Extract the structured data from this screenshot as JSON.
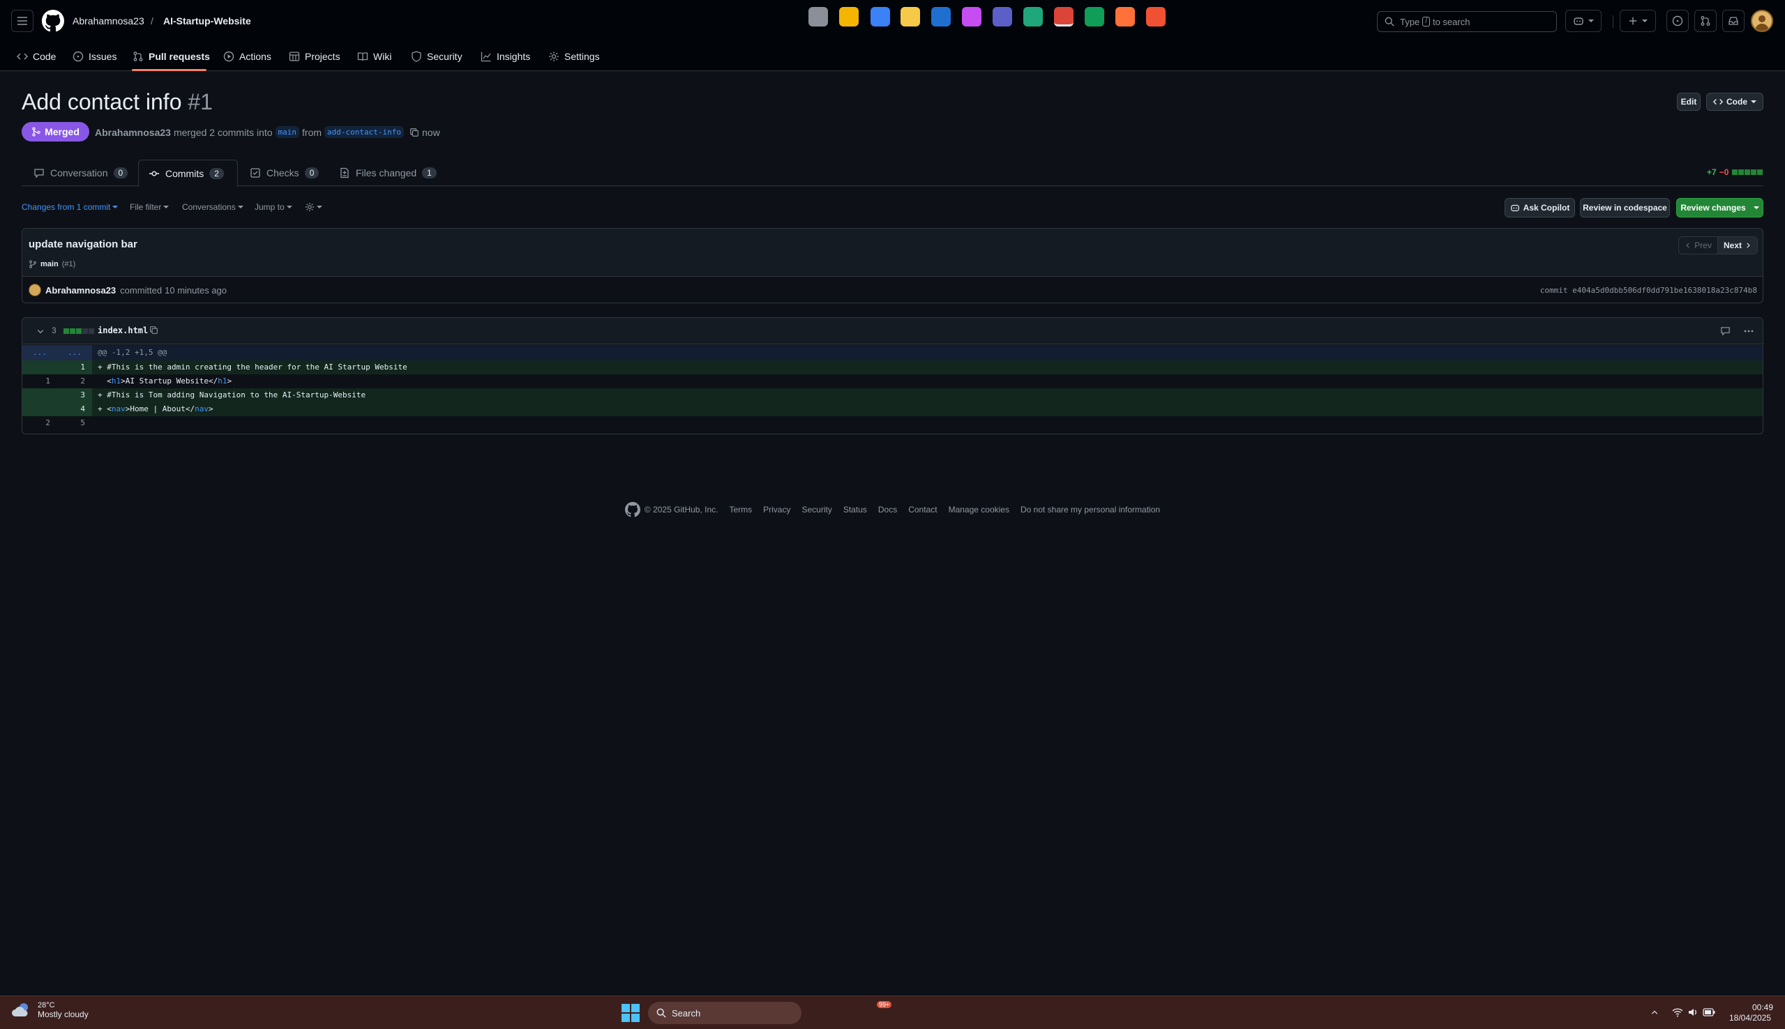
{
  "header": {
    "owner": "Abrahamnosa23",
    "separator": "/",
    "repo": "AI-Startup-Website",
    "search": {
      "prefix": "Type",
      "key": "/",
      "suffix": "to search"
    }
  },
  "repo_nav": [
    {
      "label": "Code",
      "icon": "code-icon"
    },
    {
      "label": "Issues",
      "icon": "issue-icon"
    },
    {
      "label": "Pull requests",
      "icon": "pull-request-icon"
    },
    {
      "label": "Actions",
      "icon": "play-icon"
    },
    {
      "label": "Projects",
      "icon": "table-icon"
    },
    {
      "label": "Wiki",
      "icon": "book-icon"
    },
    {
      "label": "Security",
      "icon": "shield-icon"
    },
    {
      "label": "Insights",
      "icon": "graph-icon"
    },
    {
      "label": "Settings",
      "icon": "gear-icon"
    }
  ],
  "pr": {
    "title": "Add contact info",
    "number": "#1",
    "state": "Merged",
    "author": "Abrahamnosa23",
    "merged_text": "merged 2 commits into",
    "base": "main",
    "from_text": "from",
    "head": "add-contact-info",
    "time": "now",
    "edit_label": "Edit",
    "code_label": "Code"
  },
  "tabs": [
    {
      "label": "Conversation",
      "count": "0"
    },
    {
      "label": "Commits",
      "count": "2"
    },
    {
      "label": "Checks",
      "count": "0"
    },
    {
      "label": "Files changed",
      "count": "1"
    }
  ],
  "diffstat": {
    "added": "+7",
    "removed": "−0"
  },
  "toolbar": {
    "changes_from": "Changes from 1 commit",
    "file_filter": "File filter",
    "conversations": "Conversations",
    "jump_to": "Jump to",
    "ask_copilot": "Ask Copilot",
    "review_codespace": "Review in codespace",
    "review_changes": "Review changes"
  },
  "commit": {
    "title": "update navigation bar",
    "branch": "main",
    "ref": "(#1)",
    "prev": "Prev",
    "next": "Next",
    "author": "Abrahamnosa23",
    "action": "committed",
    "time": "10 minutes ago",
    "sha_label": "commit",
    "sha": "e404a5d0dbb506df0dd791be1638018a23c874b8"
  },
  "diff": {
    "changes": "3",
    "filename": "index.html",
    "hunk": "@@ -1,2 +1,5 @@",
    "rows": [
      {
        "old": "",
        "new": "1",
        "sign": "+",
        "text": "#This is the admin creating the header for the AI Startup Website"
      },
      {
        "old": "1",
        "new": "2",
        "sign": " ",
        "pre": "<",
        "tag1": "h1",
        "mid": ">AI Startup Website</",
        "tag2": "h1",
        "post": ">"
      },
      {
        "old": "",
        "new": "3",
        "sign": "+",
        "text": "#This is Tom adding Navigation to the AI-Startup-Website"
      },
      {
        "old": "",
        "new": "4",
        "sign": "+",
        "pre": "<",
        "tag1": "nav",
        "mid": ">Home | About</",
        "tag2": "nav",
        "post": ">"
      },
      {
        "old": "2",
        "new": "5",
        "sign": " ",
        "text": ""
      }
    ]
  },
  "footer": {
    "copyright": "© 2025 GitHub, Inc.",
    "links": [
      "Terms",
      "Privacy",
      "Security",
      "Status",
      "Docs",
      "Contact",
      "Manage cookies",
      "Do not share my personal information"
    ]
  },
  "taskbar": {
    "temp": "28°C",
    "weather": "Mostly cloudy",
    "search": "Search",
    "badge": "99+",
    "time": "00:49",
    "date": "18/04/2025"
  },
  "colors": {
    "merged": "#8957e5",
    "primary_button": "#238636",
    "link": "#4493f8",
    "nav_underline": "#f78166"
  }
}
